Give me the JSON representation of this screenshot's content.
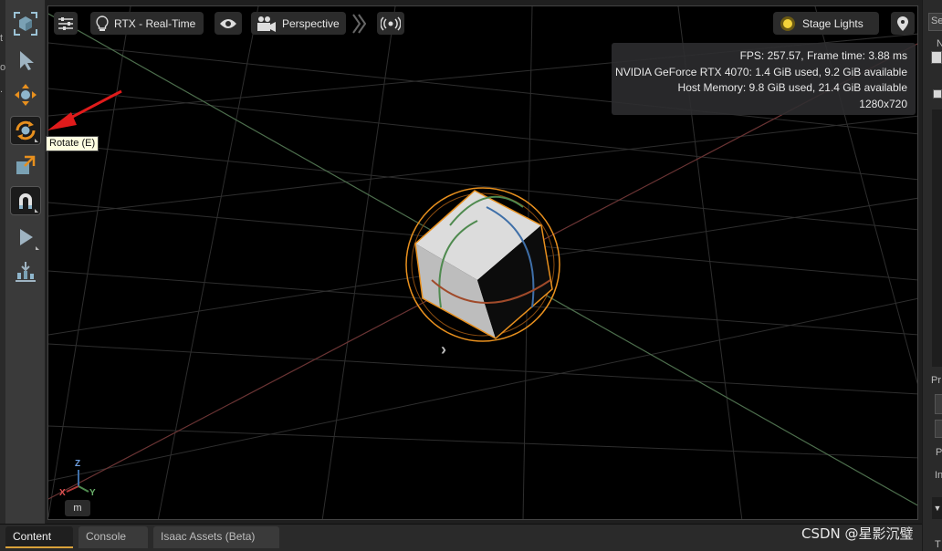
{
  "left_strip": {
    "fragment_top": "t",
    "fragment_mid": "op",
    "fragment_low": "."
  },
  "toolbar": {
    "tools": [
      {
        "name": "select-frame",
        "icon": "frame-select-icon",
        "active": false
      },
      {
        "name": "select",
        "icon": "arrow-cursor-icon",
        "active": false
      },
      {
        "name": "move",
        "icon": "move-icon",
        "active": false
      },
      {
        "name": "rotate",
        "icon": "rotate-icon",
        "active": true
      },
      {
        "name": "scale",
        "icon": "scale-icon",
        "active": false
      },
      {
        "name": "snap",
        "icon": "magnet-icon",
        "active": true
      },
      {
        "name": "play",
        "icon": "play-icon",
        "active": false
      },
      {
        "name": "physics",
        "icon": "drop-physics-icon",
        "active": false
      }
    ]
  },
  "tooltip": {
    "text": "Rotate (E)"
  },
  "viewport": {
    "settings_icon": "sliders-icon",
    "render_mode": {
      "label": "RTX - Real-Time",
      "icon": "lightbulb-icon"
    },
    "visibility_icon": "eye-icon",
    "camera": {
      "label": "Perspective",
      "icon": "camera-icon"
    },
    "expand_icon": "chevron-right-double-icon",
    "audio_icon": "broadcast-icon",
    "stage_lights": {
      "label": "Stage Lights",
      "icon": "sun-icon"
    },
    "pin_icon": "map-pin-icon",
    "hud": {
      "fps": "FPS: 257.57, Frame time: 3.88 ms",
      "gpu": "NVIDIA GeForce RTX 4070: 1.4 GiB used, 9.2 GiB available",
      "host": "Host Memory: 9.8 GiB used, 21.4 GiB available",
      "resolution": "1280x720"
    },
    "axis": {
      "z": "Z",
      "x": "X",
      "y": "Y"
    },
    "unit": "m",
    "chevron": "›"
  },
  "right_panel": {
    "frag_se": "Se",
    "frag_n": "N",
    "frag_pr": "Pr",
    "frag_p": "P",
    "frag_in": "In",
    "frag_t": "T"
  },
  "bottom_tabs": [
    {
      "label": "Content",
      "active": true
    },
    {
      "label": "Console",
      "active": false
    },
    {
      "label": "Isaac Assets (Beta)",
      "active": false
    }
  ],
  "watermark": "CSDN @星影沉璧",
  "colors": {
    "accent": "#d9a23a",
    "gizmo_orange": "#e8901e",
    "annotation_arrow": "#e01b1b"
  }
}
